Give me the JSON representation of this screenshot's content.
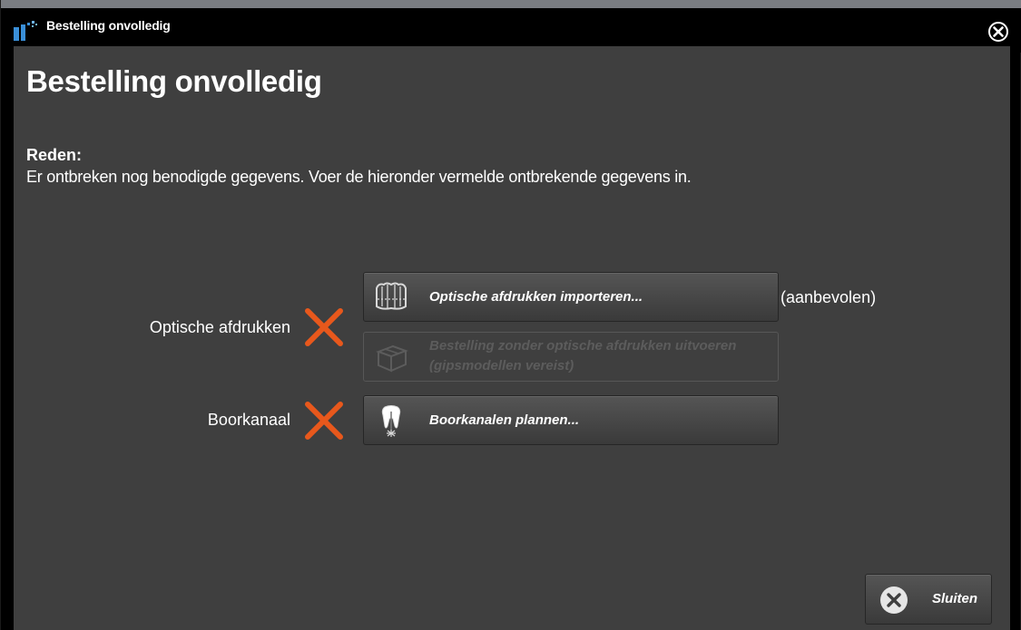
{
  "window": {
    "title": "Bestelling onvolledig",
    "colors": {
      "titlebar": "#000000",
      "content_bg": "#3f3f3f",
      "accent_icon": "#3a8fd8",
      "x_mark": "#e8581c"
    }
  },
  "dialog": {
    "heading": "Bestelling onvolledig",
    "reason_label": "Reden:",
    "reason_text": "Er ontbreken nog benodigde gegevens. Voer de hieronder vermelde ontbrekende gegevens in."
  },
  "rows": {
    "optical": {
      "label": "Optische afdrukken",
      "status_icon": "x-mark-icon",
      "import_button": "Optische afdrukken importeren...",
      "import_icon": "dental-impression-icon",
      "recommended": "(aanbevolen)",
      "without_button_line1": "Bestelling zonder optische afdrukken uitvoeren",
      "without_button_line2": "(gipsmodellen vereist)",
      "without_icon": "package-box-icon"
    },
    "drill": {
      "label": "Boorkanaal",
      "status_icon": "x-mark-icon",
      "plan_button": "Boorkanalen plannen...",
      "plan_icon": "tooth-drill-icon"
    }
  },
  "footer": {
    "close_button": "Sluiten",
    "close_icon": "circle-close-icon"
  }
}
